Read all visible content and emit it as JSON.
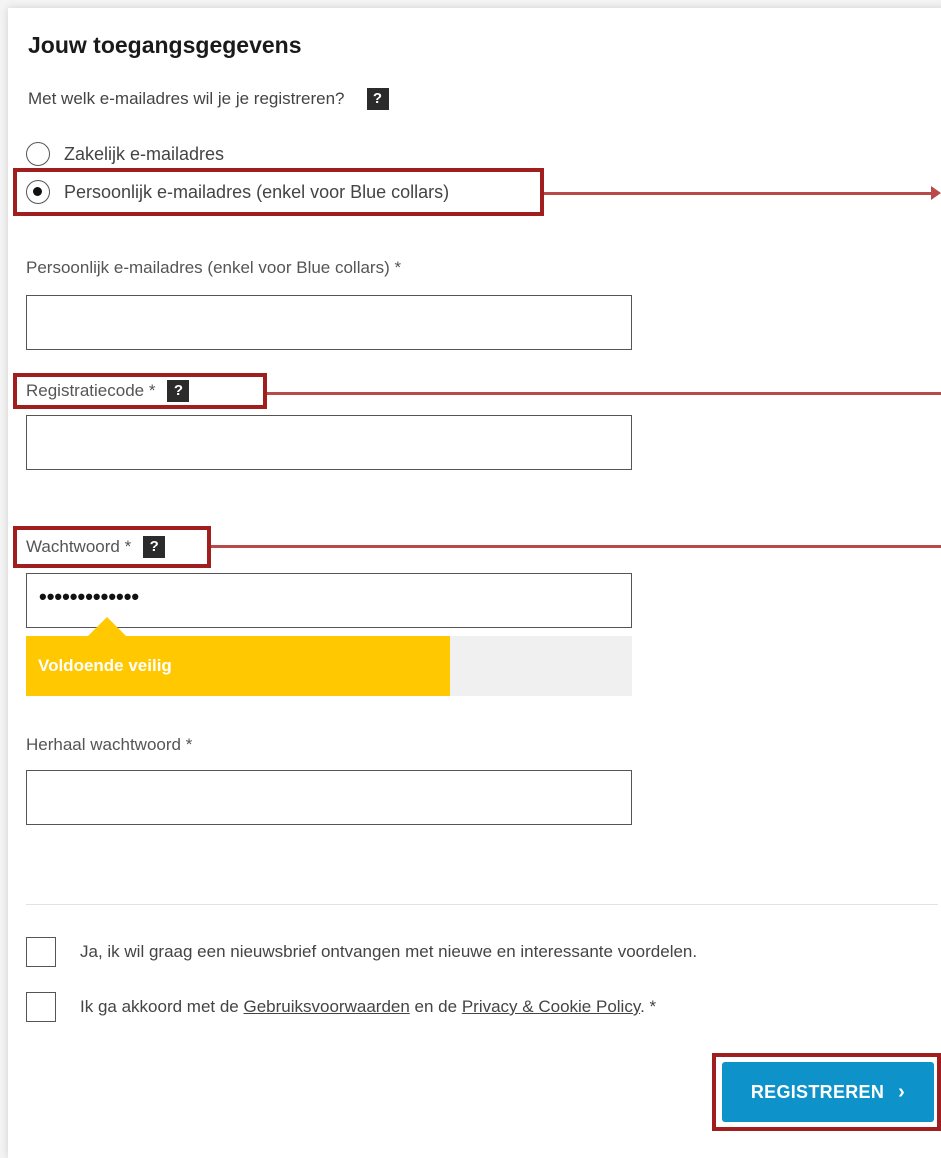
{
  "form": {
    "title": "Jouw toegangsgegevens",
    "question": "Met welk e-mailadres wil je je registreren?",
    "help_glyph": "?",
    "email_options": [
      {
        "label": "Zakelijk e-mailadres",
        "selected": false
      },
      {
        "label": "Persoonlijk e-mailadres (enkel voor Blue collars)",
        "selected": true
      }
    ],
    "personal_email": {
      "label": "Persoonlijk e-mailadres (enkel voor Blue collars) *",
      "value": ""
    },
    "registration_code": {
      "label": "Registratiecode *",
      "value": ""
    },
    "password": {
      "label": "Wachtwoord *",
      "value": "•••••••••••••"
    },
    "password_strength": {
      "label": "Voldoende veilig",
      "level_fraction": 0.7,
      "color": "#ffc800"
    },
    "repeat_password": {
      "label": "Herhaal wachtwoord *",
      "value": ""
    },
    "newsletter": {
      "label": "Ja, ik wil graag een nieuwsbrief ontvangen met nieuwe en interessante voordelen.",
      "checked": false
    },
    "terms": {
      "prefix": "Ik ga akkoord met de",
      "terms_link": "Gebruiksvoorwaarden",
      "middle": "en de",
      "privacy_link": "Privacy & Cookie Policy",
      "suffix": ". *",
      "checked": false
    },
    "submit_label": "REGISTREREN",
    "submit_chevron": "›"
  },
  "colors": {
    "accent": "#0d93c9",
    "highlight": "#a01e1e",
    "annotation_arrow": "#b94a4a",
    "strength": "#ffc800"
  }
}
